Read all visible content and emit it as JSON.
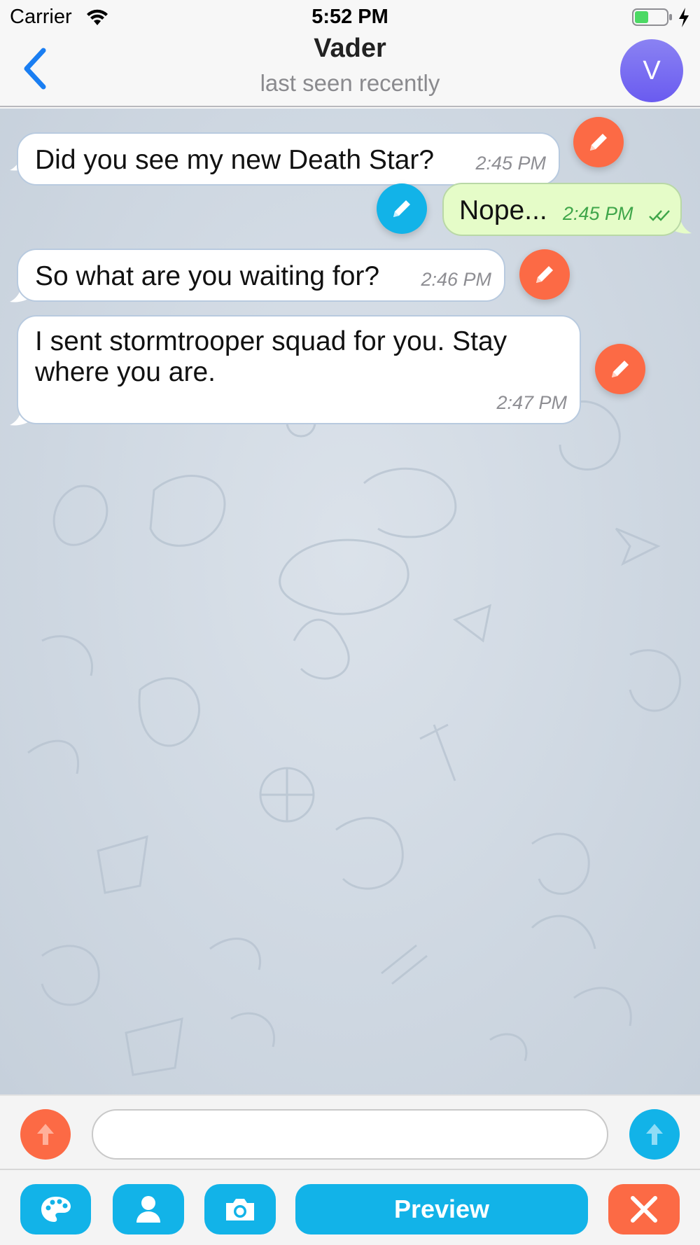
{
  "status_bar": {
    "carrier": "Carrier",
    "time": "5:52 PM"
  },
  "header": {
    "title": "Vader",
    "subtitle": "last seen recently",
    "avatar_initial": "V"
  },
  "messages": [
    {
      "direction": "incoming",
      "text": "Did you see my new Death Star?",
      "time": "2:45 PM"
    },
    {
      "direction": "outgoing",
      "text": "Nope...",
      "time": "2:45 PM",
      "read": true
    },
    {
      "direction": "incoming",
      "text": "So what are you waiting for?",
      "time": "2:46 PM"
    },
    {
      "direction": "incoming",
      "text": [
        "I sent stormtrooper squad for you. Stay",
        "where you are."
      ],
      "time": "2:47 PM"
    }
  ],
  "composer": {
    "value": "",
    "placeholder": ""
  },
  "toolbar": {
    "preview_label": "Preview",
    "icons": [
      "palette-icon",
      "person-icon",
      "camera-icon",
      "close-icon"
    ]
  },
  "colors": {
    "accent_blue": "#12b3e8",
    "accent_orange": "#fc6a45",
    "back_blue": "#1a7ef2",
    "incoming_bubble": "#ffffff",
    "outgoing_bubble": "#e5fcc8",
    "avatar": "#7b6ff2"
  }
}
